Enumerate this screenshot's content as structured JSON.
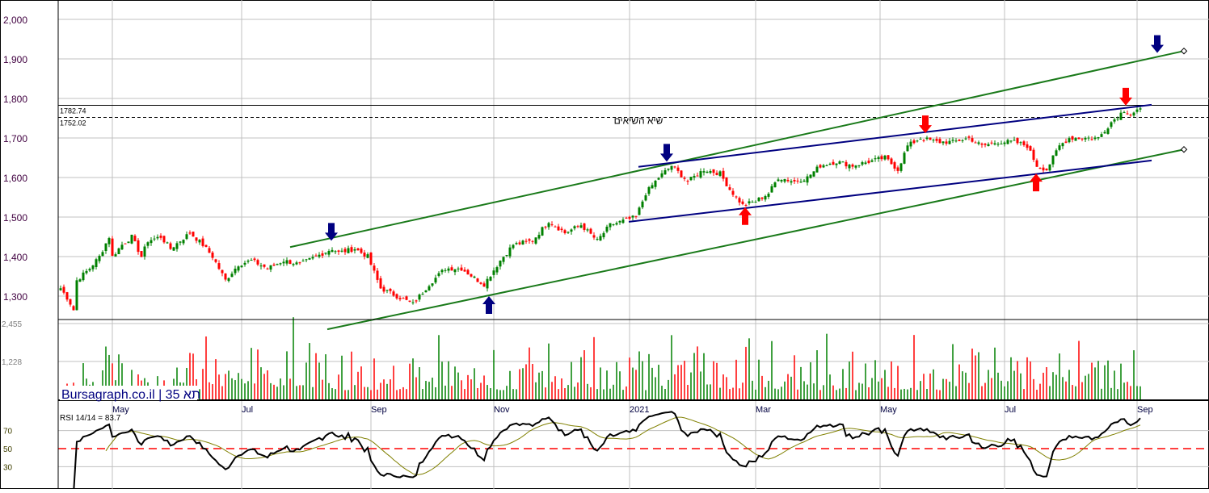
{
  "chart_data": {
    "type": "candlestick",
    "title": "תא 35",
    "watermark": "Bursagraph.co.il | תא 35",
    "price_axis": {
      "ticks": [
        "2,000",
        "1,900",
        "1,800",
        "1,700",
        "1,600",
        "1,500",
        "1,400",
        "1,300"
      ],
      "values": [
        2000,
        1900,
        1800,
        1700,
        1600,
        1500,
        1400,
        1300
      ],
      "range": [
        1245,
        2047
      ]
    },
    "volume_axis": {
      "ticks": [
        "2,455",
        "1,228"
      ],
      "values": [
        2455,
        1228
      ]
    },
    "rsi_axis": {
      "ticks": [
        "70",
        "50",
        "30"
      ],
      "values": [
        70,
        50,
        30
      ],
      "reference": 50
    },
    "rsi_label": "RSI 14/14 = 83.7",
    "x_labels": [
      {
        "label": "May",
        "bar": 16
      },
      {
        "label": "Jul",
        "bar": 56
      },
      {
        "label": "Sep",
        "bar": 96
      },
      {
        "label": "Nov",
        "bar": 134
      },
      {
        "label": "2021",
        "bar": 176
      },
      {
        "label": "Mar",
        "bar": 215
      },
      {
        "label": "May",
        "bar": 253.5
      },
      {
        "label": "Jul",
        "bar": 292
      },
      {
        "label": "Sep",
        "bar": 333
      }
    ],
    "close_path": [
      [
        0,
        1320
      ],
      [
        2.5,
        1290
      ],
      [
        4,
        1265
      ],
      [
        5,
        1340
      ],
      [
        9,
        1370
      ],
      [
        12,
        1400
      ],
      [
        15,
        1450
      ],
      [
        16,
        1400
      ],
      [
        19,
        1430
      ],
      [
        22,
        1450
      ],
      [
        25,
        1400
      ],
      [
        27,
        1440
      ],
      [
        31,
        1450
      ],
      [
        34,
        1420
      ],
      [
        37,
        1440
      ],
      [
        40,
        1460
      ],
      [
        44,
        1430
      ],
      [
        47,
        1400
      ],
      [
        51,
        1340
      ],
      [
        55,
        1380
      ],
      [
        59,
        1390
      ],
      [
        64,
        1370
      ],
      [
        69,
        1390
      ],
      [
        74,
        1380
      ],
      [
        79,
        1400
      ],
      [
        84,
        1420
      ],
      [
        86,
        1410
      ],
      [
        91,
        1420
      ],
      [
        95,
        1400
      ],
      [
        99,
        1320
      ],
      [
        104,
        1300
      ],
      [
        109,
        1280
      ],
      [
        114,
        1330
      ],
      [
        119,
        1370
      ],
      [
        124,
        1370
      ],
      [
        129,
        1340
      ],
      [
        131,
        1330
      ],
      [
        136,
        1390
      ],
      [
        140,
        1430
      ],
      [
        146,
        1440
      ],
      [
        151,
        1490
      ],
      [
        156,
        1460
      ],
      [
        161,
        1480
      ],
      [
        166,
        1440
      ],
      [
        170,
        1480
      ],
      [
        174,
        1490
      ],
      [
        178,
        1500
      ],
      [
        181,
        1560
      ],
      [
        185,
        1600
      ],
      [
        189,
        1630
      ],
      [
        194,
        1590
      ],
      [
        199,
        1620
      ],
      [
        204,
        1610
      ],
      [
        207,
        1570
      ],
      [
        211,
        1530
      ],
      [
        215,
        1540
      ],
      [
        219,
        1560
      ],
      [
        222,
        1600
      ],
      [
        227,
        1590
      ],
      [
        231,
        1600
      ],
      [
        235,
        1630
      ],
      [
        240,
        1640
      ],
      [
        245,
        1630
      ],
      [
        250,
        1640
      ],
      [
        255,
        1650
      ],
      [
        259,
        1620
      ],
      [
        262,
        1680
      ],
      [
        266,
        1700
      ],
      [
        271,
        1690
      ],
      [
        276,
        1690
      ],
      [
        281,
        1700
      ],
      [
        285,
        1680
      ],
      [
        290,
        1690
      ],
      [
        295,
        1690
      ],
      [
        299,
        1680
      ],
      [
        302,
        1630
      ],
      [
        305,
        1620
      ],
      [
        309,
        1680
      ],
      [
        312,
        1700
      ],
      [
        316,
        1700
      ],
      [
        321,
        1700
      ],
      [
        325,
        1740
      ],
      [
        329,
        1770
      ],
      [
        331,
        1760
      ],
      [
        334,
        1775
      ]
    ],
    "levels": [
      {
        "label": "1782.74",
        "value": 1782.74,
        "style": "solid"
      },
      {
        "label": "1752.02",
        "value": 1752.02,
        "style": "dashed",
        "note": "שיא השיאים"
      }
    ],
    "trend_lines": [
      {
        "name": "upper-channel",
        "color": "#1a7a1a",
        "from": [
          71,
          1424
        ],
        "to": [
          347.5,
          1920
        ],
        "end_marker": true
      },
      {
        "name": "lower-channel",
        "color": "#1a7a1a",
        "from": [
          82.5,
          1216
        ],
        "to": [
          347.5,
          1671
        ],
        "end_marker": true
      },
      {
        "name": "upper-wedge",
        "color": "#000080",
        "from": [
          178.75,
          1627
        ],
        "to": [
          337.5,
          1784
        ]
      },
      {
        "name": "lower-wedge",
        "color": "#000080",
        "from": [
          175.75,
          1488
        ],
        "to": [
          337.5,
          1643
        ]
      }
    ],
    "signals": [
      {
        "type": "down",
        "color": "#000080",
        "bar": 83.75,
        "price": 1440
      },
      {
        "type": "down",
        "color": "#000080",
        "bar": 187.5,
        "price": 1640
      },
      {
        "type": "down",
        "color": "#000080",
        "bar": 339.25,
        "price": 1915
      },
      {
        "type": "up",
        "color": "#000080",
        "bar": 132.5,
        "price": 1300
      },
      {
        "type": "down",
        "color": "#ff0000",
        "bar": 267.5,
        "price": 1712
      },
      {
        "type": "down",
        "color": "#ff0000",
        "bar": 329.5,
        "price": 1782
      },
      {
        "type": "up",
        "color": "#ff0000",
        "bar": 211.75,
        "price": 1525
      },
      {
        "type": "up",
        "color": "#ff0000",
        "bar": 301.75,
        "price": 1610
      }
    ],
    "colors": {
      "up": "#008000",
      "down": "#ff0000",
      "rsi": "#000000",
      "rsi_ma": "#808000",
      "ref": "#ff0000",
      "grid": "#c0c0c0"
    }
  }
}
